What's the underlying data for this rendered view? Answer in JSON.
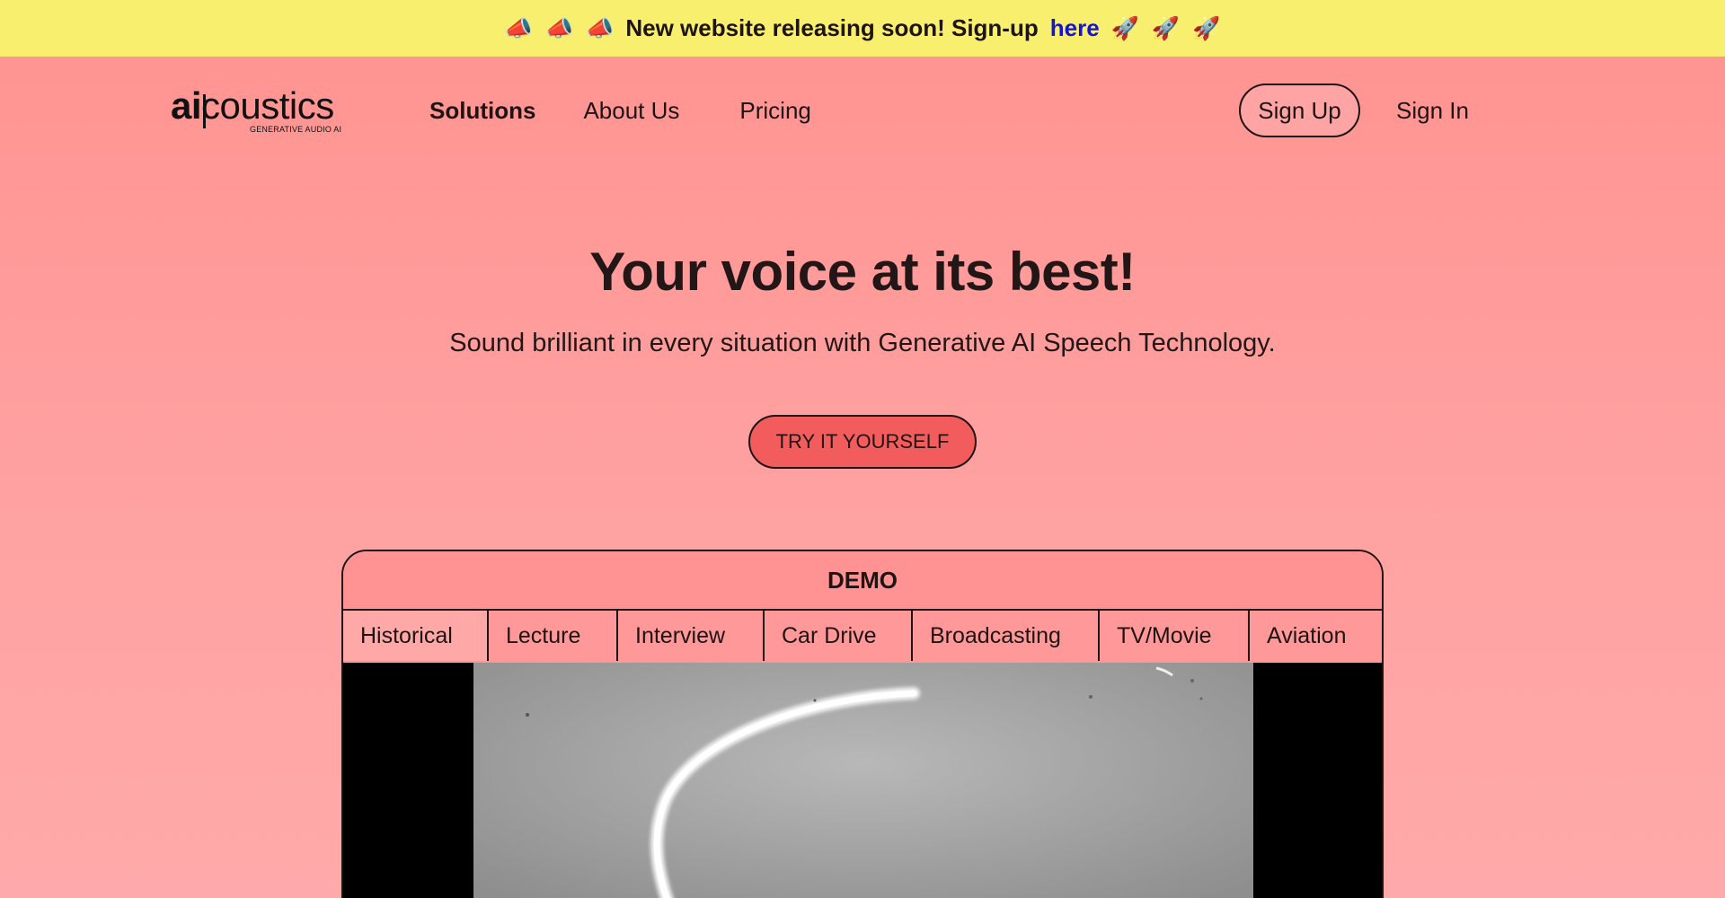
{
  "announcement": {
    "emoji_left": "📣",
    "emoji_right": "🚀",
    "message": "New website releasing soon! Sign-up",
    "link": "here"
  },
  "logo": {
    "ai": "ai",
    "coustics": "coustics",
    "tagline": "GENERATIVE AUDIO AI"
  },
  "nav": {
    "items": [
      {
        "label": "Solutions"
      },
      {
        "label": "About Us"
      },
      {
        "label": "Pricing"
      }
    ],
    "signup": "Sign Up",
    "signin": "Sign In"
  },
  "hero": {
    "title": "Your voice at its best!",
    "subtitle": "Sound brilliant in every situation with Generative AI Speech Technology.",
    "cta": "TRY IT YOURSELF"
  },
  "demo": {
    "title": "DEMO",
    "tabs": [
      {
        "label": "Historical"
      },
      {
        "label": "Lecture"
      },
      {
        "label": "Interview"
      },
      {
        "label": "Car Drive"
      },
      {
        "label": "Broadcasting"
      },
      {
        "label": "TV/Movie"
      },
      {
        "label": "Aviation"
      }
    ],
    "active_tab": "Historical"
  },
  "colors": {
    "announce_bg": "#f8ef6f",
    "link": "#1414d8",
    "page_bg": "#ff9a98",
    "cta_bg": "#f25c5c"
  }
}
